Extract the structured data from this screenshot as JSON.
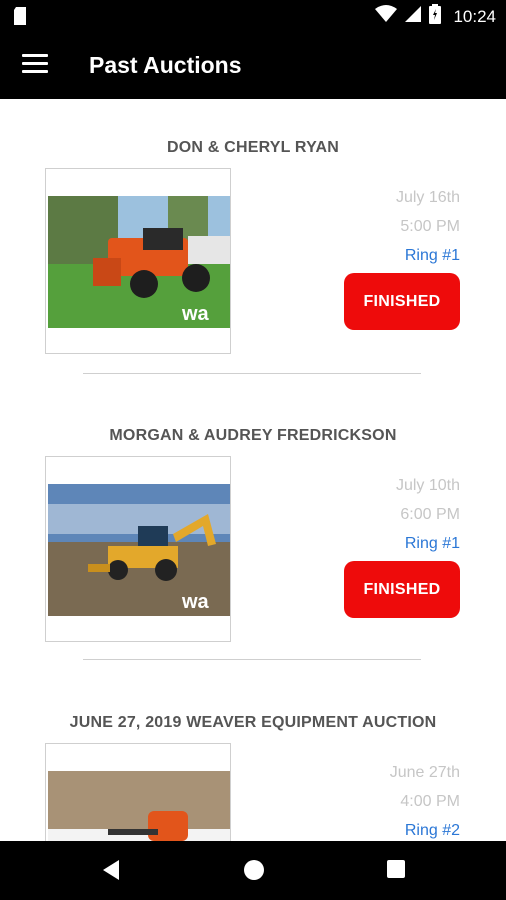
{
  "status_bar": {
    "time": "10:24"
  },
  "app_bar": {
    "title": "Past Auctions",
    "menu_icon": "hamburger-menu-icon"
  },
  "auctions": [
    {
      "title": "DON & CHERYL RYAN",
      "date": "July 16th",
      "time": "5:00 PM",
      "ring": "Ring #1",
      "status": "FINISHED",
      "image_watermark": "wa"
    },
    {
      "title": "MORGAN & AUDREY FREDRICKSON",
      "date": "July 10th",
      "time": "6:00 PM",
      "ring": "Ring #1",
      "status": "FINISHED",
      "image_watermark": "wa"
    },
    {
      "title": "JUNE 27, 2019 WEAVER EQUIPMENT AUCTION",
      "date": "June 27th",
      "time": "4:00 PM",
      "ring": "Ring #2"
    }
  ],
  "colors": {
    "status_finished": "#ee0b0b",
    "ring_link": "#2b77d6",
    "muted_text": "#c6c6c6",
    "title_text": "#555555"
  }
}
